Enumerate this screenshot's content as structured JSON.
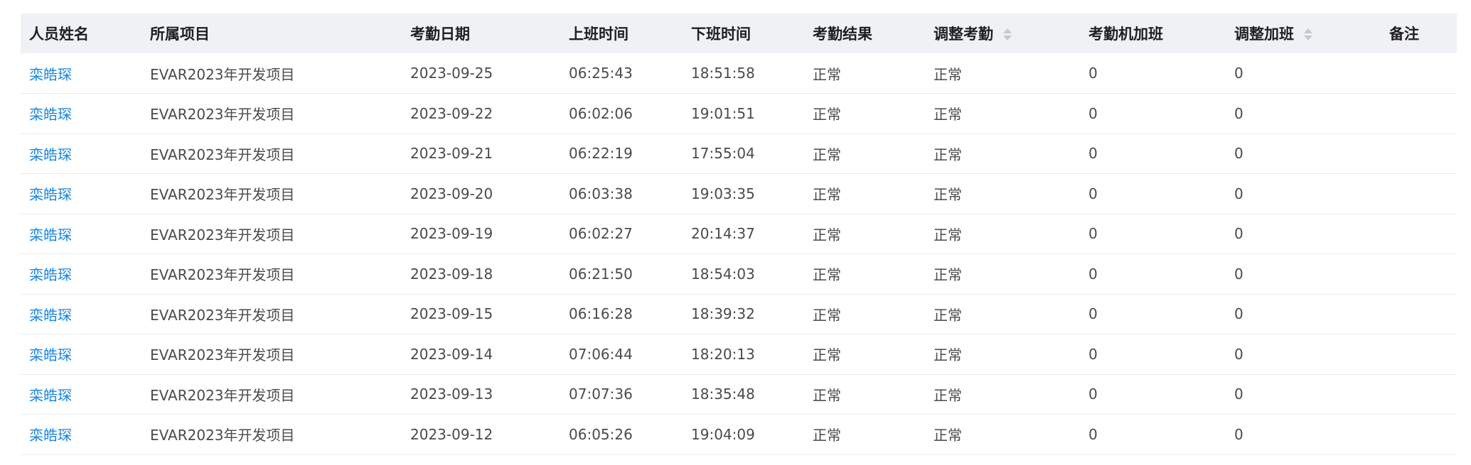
{
  "colors": {
    "header_bg": "#eff1f5",
    "link": "#1a86e0",
    "text": "#4a4a4a",
    "row_border": "#e9ebef"
  },
  "table": {
    "headers": {
      "name": "人员姓名",
      "project": "所属项目",
      "date": "考勤日期",
      "clock_in": "上班时间",
      "clock_out": "下班时间",
      "result": "考勤结果",
      "adjusted_result": "调整考勤",
      "machine_overtime": "考勤机加班",
      "adjusted_overtime": "调整加班",
      "remark": "备注"
    },
    "rows": [
      {
        "name": "栾皓琛",
        "project": "EVAR2023年开发项目",
        "date": "2023-09-25",
        "clock_in": "06:25:43",
        "clock_out": "18:51:58",
        "result": "正常",
        "adjusted_result": "正常",
        "machine_overtime": "0",
        "adjusted_overtime": "0",
        "remark": ""
      },
      {
        "name": "栾皓琛",
        "project": "EVAR2023年开发项目",
        "date": "2023-09-22",
        "clock_in": "06:02:06",
        "clock_out": "19:01:51",
        "result": "正常",
        "adjusted_result": "正常",
        "machine_overtime": "0",
        "adjusted_overtime": "0",
        "remark": ""
      },
      {
        "name": "栾皓琛",
        "project": "EVAR2023年开发项目",
        "date": "2023-09-21",
        "clock_in": "06:22:19",
        "clock_out": "17:55:04",
        "result": "正常",
        "adjusted_result": "正常",
        "machine_overtime": "0",
        "adjusted_overtime": "0",
        "remark": ""
      },
      {
        "name": "栾皓琛",
        "project": "EVAR2023年开发项目",
        "date": "2023-09-20",
        "clock_in": "06:03:38",
        "clock_out": "19:03:35",
        "result": "正常",
        "adjusted_result": "正常",
        "machine_overtime": "0",
        "adjusted_overtime": "0",
        "remark": ""
      },
      {
        "name": "栾皓琛",
        "project": "EVAR2023年开发项目",
        "date": "2023-09-19",
        "clock_in": "06:02:27",
        "clock_out": "20:14:37",
        "result": "正常",
        "adjusted_result": "正常",
        "machine_overtime": "0",
        "adjusted_overtime": "0",
        "remark": ""
      },
      {
        "name": "栾皓琛",
        "project": "EVAR2023年开发项目",
        "date": "2023-09-18",
        "clock_in": "06:21:50",
        "clock_out": "18:54:03",
        "result": "正常",
        "adjusted_result": "正常",
        "machine_overtime": "0",
        "adjusted_overtime": "0",
        "remark": ""
      },
      {
        "name": "栾皓琛",
        "project": "EVAR2023年开发项目",
        "date": "2023-09-15",
        "clock_in": "06:16:28",
        "clock_out": "18:39:32",
        "result": "正常",
        "adjusted_result": "正常",
        "machine_overtime": "0",
        "adjusted_overtime": "0",
        "remark": ""
      },
      {
        "name": "栾皓琛",
        "project": "EVAR2023年开发项目",
        "date": "2023-09-14",
        "clock_in": "07:06:44",
        "clock_out": "18:20:13",
        "result": "正常",
        "adjusted_result": "正常",
        "machine_overtime": "0",
        "adjusted_overtime": "0",
        "remark": ""
      },
      {
        "name": "栾皓琛",
        "project": "EVAR2023年开发项目",
        "date": "2023-09-13",
        "clock_in": "07:07:36",
        "clock_out": "18:35:48",
        "result": "正常",
        "adjusted_result": "正常",
        "machine_overtime": "0",
        "adjusted_overtime": "0",
        "remark": ""
      },
      {
        "name": "栾皓琛",
        "project": "EVAR2023年开发项目",
        "date": "2023-09-12",
        "clock_in": "06:05:26",
        "clock_out": "19:04:09",
        "result": "正常",
        "adjusted_result": "正常",
        "machine_overtime": "0",
        "adjusted_overtime": "0",
        "remark": ""
      }
    ]
  }
}
